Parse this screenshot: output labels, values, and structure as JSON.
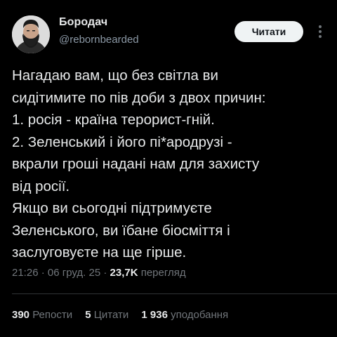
{
  "author": {
    "display_name": "Бородач",
    "handle": "@rebornbearded"
  },
  "follow_button_label": "Читати",
  "icons": {
    "more": "more-vertical-icon",
    "avatar": "avatar-image"
  },
  "tweet_text": "Нагадаю вам, що без світла ви\nсидітимите по пів доби з двох причин:\n1. росія - країна терорист-гній.\n2. Зеленський і його пі*ародрузі -\nвкрали гроші надані нам для захисту\nвід росії.\nЯкщо ви сьогодні підтримуєте\nЗеленського, ви їбане біосміття і\nзаслуговуєте на ще гірше.",
  "meta": {
    "time": "21:26",
    "date": "06 груд. 25",
    "separator": "·",
    "views_count": "23,7K",
    "views_label": "перегляд"
  },
  "stats": [
    {
      "count": "390",
      "label": "Репости"
    },
    {
      "count": "5",
      "label": "Цитати"
    },
    {
      "count": "1 936",
      "label": "уподобання"
    }
  ],
  "colors": {
    "background": "#000000",
    "text_primary": "#e7e9ea",
    "text_secondary": "#71767b",
    "button_bg": "#eff3f4"
  }
}
